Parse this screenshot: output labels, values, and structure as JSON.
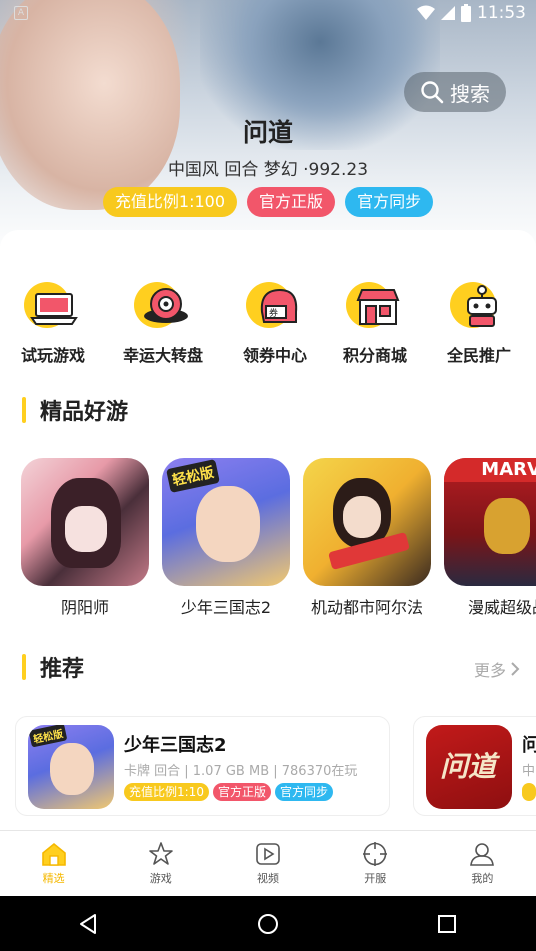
{
  "status_bar": {
    "time": "11:53",
    "notification_glyph": "A"
  },
  "hero": {
    "search_label": "搜索",
    "title": "问道",
    "meta": "中国风 回合 梦幻 ·992.23",
    "tags": [
      {
        "label": "充值比例1:100",
        "color": "#f8c91e"
      },
      {
        "label": "官方正版",
        "color": "#f2566a"
      },
      {
        "label": "官方同步",
        "color": "#2eb8f0"
      }
    ]
  },
  "quick_actions": [
    {
      "label": "试玩游戏",
      "icon": "laptop-icon"
    },
    {
      "label": "幸运大转盘",
      "icon": "wheel-icon"
    },
    {
      "label": "领券中心",
      "icon": "helmet-icon"
    },
    {
      "label": "积分商城",
      "icon": "store-icon"
    },
    {
      "label": "全民推广",
      "icon": "robot-icon"
    }
  ],
  "featured": {
    "title": "精品好游",
    "games": [
      {
        "name": "阴阳师"
      },
      {
        "name": "少年三国志2",
        "badge": "轻松版"
      },
      {
        "name": "机动都市阿尔法"
      },
      {
        "name": "漫威超级战",
        "badge": "MARVEL"
      }
    ]
  },
  "recommend": {
    "title": "推荐",
    "more_label": "更多",
    "items": [
      {
        "title": "少年三国志2",
        "meta": "卡牌 回合 | 1.07 GB MB | 786370在玩",
        "badge": "轻松版",
        "tags": [
          "充值比例1:10",
          "官方正版",
          "官方同步"
        ]
      },
      {
        "title": "问",
        "meta": "中",
        "logo_text": "问道"
      }
    ]
  },
  "bottom_nav": [
    {
      "label": "精选",
      "active": true
    },
    {
      "label": "游戏",
      "active": false
    },
    {
      "label": "视频",
      "active": false
    },
    {
      "label": "开服",
      "active": false
    },
    {
      "label": "我的",
      "active": false
    }
  ],
  "colors": {
    "accent": "#ffcf1f",
    "active_nav": "#f5b800",
    "pink": "#f2566a",
    "blue": "#2eb8f0"
  }
}
